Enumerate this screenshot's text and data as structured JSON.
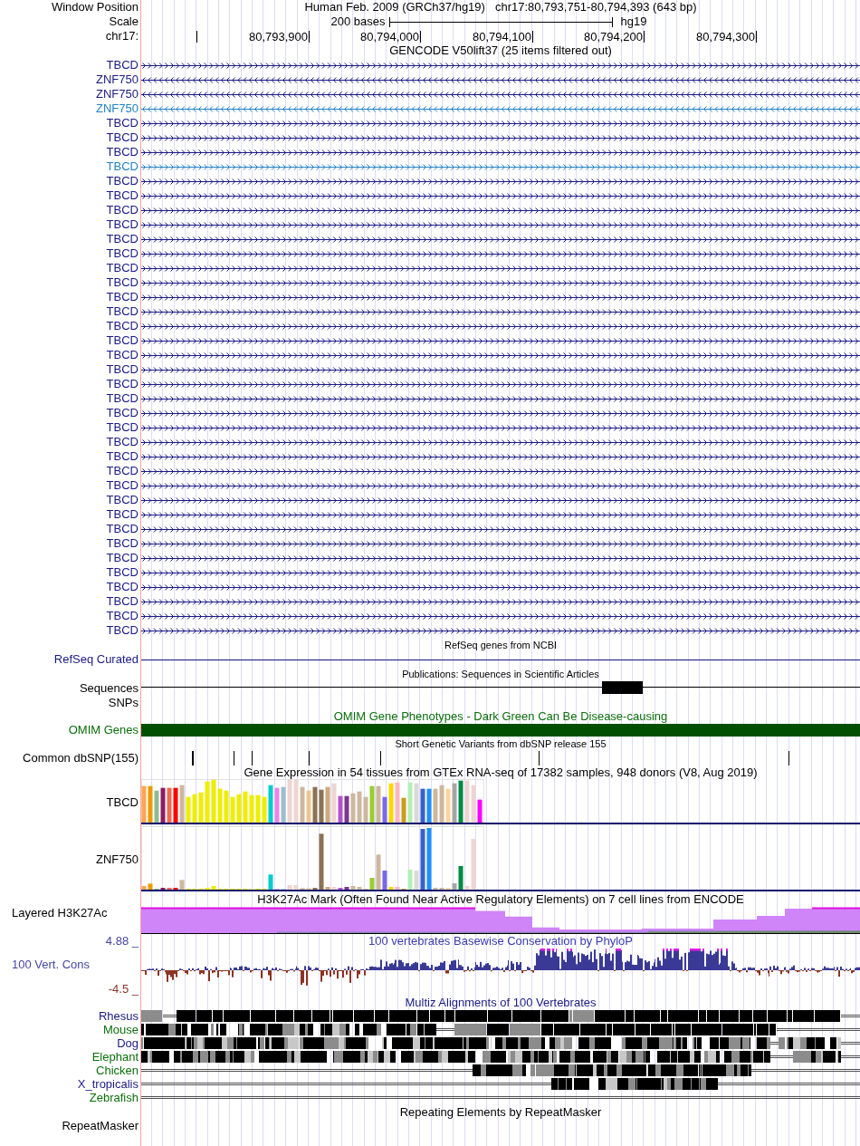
{
  "header": {
    "window_label": "Window Position",
    "assembly": "Human Feb. 2009 (GRCh37/hg19)",
    "position": "chr17:80,793,751-80,794,393 (643 bp)",
    "scale_label": "Scale",
    "scale_length": "200 bases",
    "scale_assembly": "hg19",
    "chrom_label": "chr17:",
    "ruler_ticks": [
      "80,793,900",
      "80,794,000",
      "80,794,100",
      "80,794,200",
      "80,794,300"
    ]
  },
  "gencode": {
    "title": "GENCODE V50lift37 (25 items filtered out)",
    "items": [
      {
        "name": "TBCD",
        "reverse": false,
        "color": "#1a1a84"
      },
      {
        "name": "ZNF750",
        "reverse": true,
        "color": "#1a1a84"
      },
      {
        "name": "ZNF750",
        "reverse": true,
        "color": "#1a1a84"
      },
      {
        "name": "ZNF750",
        "reverse": true,
        "color": "#2382c4"
      },
      {
        "name": "TBCD",
        "reverse": false,
        "color": "#1a1a84"
      },
      {
        "name": "TBCD",
        "reverse": false,
        "color": "#1a1a84"
      },
      {
        "name": "TBCD",
        "reverse": false,
        "color": "#1a1a84"
      },
      {
        "name": "TBCD",
        "reverse": false,
        "color": "#2382c4"
      },
      {
        "name": "TBCD",
        "reverse": false,
        "color": "#1a1a84"
      },
      {
        "name": "TBCD",
        "reverse": false,
        "color": "#1a1a84"
      },
      {
        "name": "TBCD",
        "reverse": false,
        "color": "#1a1a84"
      },
      {
        "name": "TBCD",
        "reverse": false,
        "color": "#1a1a84"
      },
      {
        "name": "TBCD",
        "reverse": false,
        "color": "#1a1a84"
      },
      {
        "name": "TBCD",
        "reverse": false,
        "color": "#1a1a84"
      },
      {
        "name": "TBCD",
        "reverse": false,
        "color": "#1a1a84"
      },
      {
        "name": "TBCD",
        "reverse": false,
        "color": "#1a1a84"
      },
      {
        "name": "TBCD",
        "reverse": false,
        "color": "#1a1a84"
      },
      {
        "name": "TBCD",
        "reverse": false,
        "color": "#1a1a84"
      },
      {
        "name": "TBCD",
        "reverse": false,
        "color": "#1a1a84"
      },
      {
        "name": "TBCD",
        "reverse": false,
        "color": "#1a1a84"
      },
      {
        "name": "TBCD",
        "reverse": false,
        "color": "#1a1a84"
      },
      {
        "name": "TBCD",
        "reverse": false,
        "color": "#1a1a84"
      },
      {
        "name": "TBCD",
        "reverse": false,
        "color": "#1a1a84"
      },
      {
        "name": "TBCD",
        "reverse": false,
        "color": "#1a1a84"
      },
      {
        "name": "TBCD",
        "reverse": false,
        "color": "#1a1a84"
      },
      {
        "name": "TBCD",
        "reverse": false,
        "color": "#1a1a84"
      },
      {
        "name": "TBCD",
        "reverse": false,
        "color": "#1a1a84"
      },
      {
        "name": "TBCD",
        "reverse": false,
        "color": "#1a1a84"
      },
      {
        "name": "TBCD",
        "reverse": false,
        "color": "#1a1a84"
      },
      {
        "name": "TBCD",
        "reverse": false,
        "color": "#1a1a84"
      },
      {
        "name": "TBCD",
        "reverse": false,
        "color": "#1a1a84"
      },
      {
        "name": "TBCD",
        "reverse": false,
        "color": "#1a1a84"
      },
      {
        "name": "TBCD",
        "reverse": false,
        "color": "#1a1a84"
      },
      {
        "name": "TBCD",
        "reverse": false,
        "color": "#1a1a84"
      },
      {
        "name": "TBCD",
        "reverse": false,
        "color": "#1a1a84"
      },
      {
        "name": "TBCD",
        "reverse": false,
        "color": "#1a1a84"
      },
      {
        "name": "TBCD",
        "reverse": false,
        "color": "#1a1a84"
      },
      {
        "name": "TBCD",
        "reverse": false,
        "color": "#1a1a84"
      },
      {
        "name": "TBCD",
        "reverse": false,
        "color": "#1a1a84"
      },
      {
        "name": "TBCD",
        "reverse": false,
        "color": "#1a1a84"
      }
    ]
  },
  "refseq": {
    "title": "RefSeq genes from NCBI",
    "label": "RefSeq Curated"
  },
  "publications": {
    "title": "Publications: Sequences in Scientific Articles",
    "labels": [
      "Sequences",
      "SNPs"
    ]
  },
  "omim": {
    "title": "OMIM Gene Phenotypes - Dark Green Can Be Disease-causing",
    "label": "OMIM Genes"
  },
  "dbsnp": {
    "title": "Short Genetic Variants from dbSNP release 155",
    "label": "Common dbSNP(155)"
  },
  "gtex": {
    "title": "Gene Expression in 54 tissues from GTEx RNA-seq of 17382 samples, 948 donors (V8, Aug 2019)",
    "genes": [
      "TBCD",
      "ZNF750"
    ]
  },
  "h3k27ac": {
    "title": "H3K27Ac Mark (Often Found Near Active Regulatory Elements) on 7 cell lines from ENCODE",
    "label": "Layered H3K27Ac"
  },
  "phylop": {
    "title": "100 vertebrates Basewise Conservation by PhyloP",
    "label": "100 Vert. Cons",
    "max_label": "4.88 _",
    "min_label": "-4.5 _"
  },
  "multiz": {
    "title": "Multiz Alignments of 100 Vertebrates",
    "species": [
      {
        "name": "Rhesus",
        "color": "#1a1a84"
      },
      {
        "name": "Mouse",
        "color": "#0b6e0b"
      },
      {
        "name": "Dog",
        "color": "#1a1a84"
      },
      {
        "name": "Elephant",
        "color": "#0b6e0b"
      },
      {
        "name": "Chicken",
        "color": "#0b6e0b"
      },
      {
        "name": "X_tropicalis",
        "color": "#1a1a84"
      },
      {
        "name": "Zebrafish",
        "color": "#0b6e0b"
      }
    ]
  },
  "repeatmasker": {
    "title": "Repeating Elements by RepeatMasker",
    "label": "RepeatMasker"
  }
}
